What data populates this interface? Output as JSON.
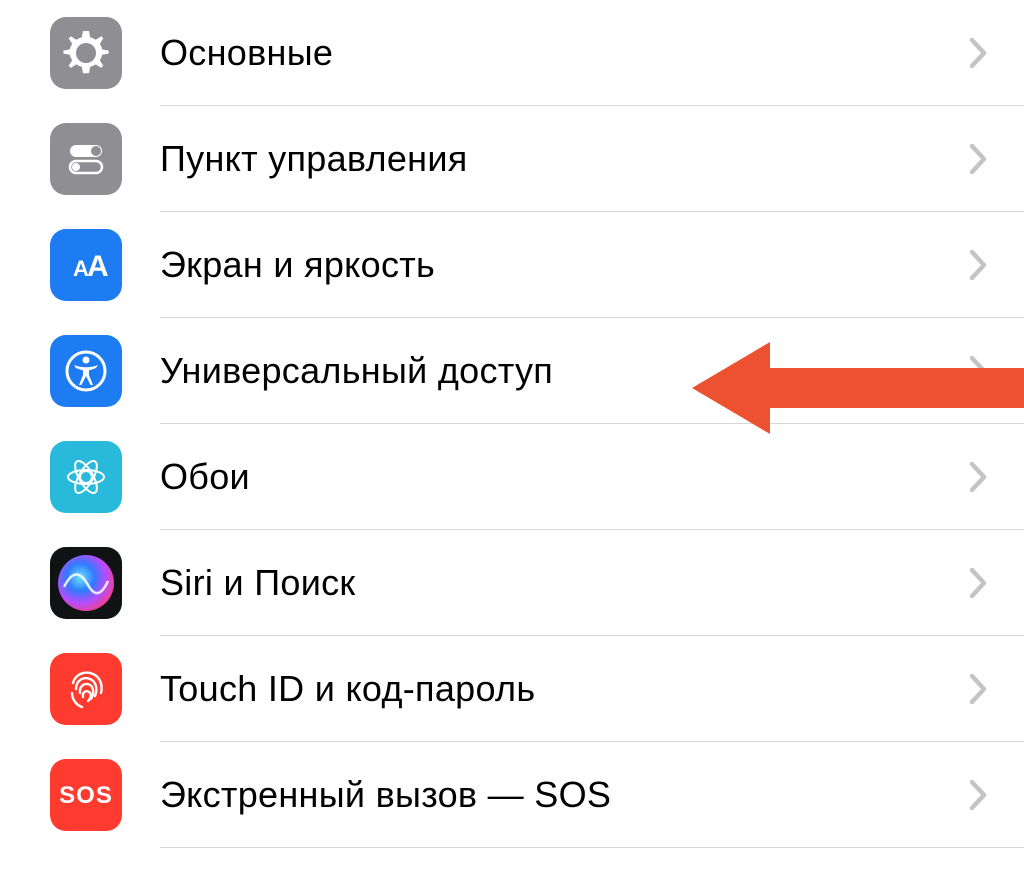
{
  "colors": {
    "gray": "#8e8e93",
    "blue": "#1e7cf3",
    "cyan": "#29badb",
    "red": "#ff3a2f",
    "sosRed": "#ff3a2f",
    "dark": "#111214",
    "arrow": "#ec5232",
    "chevron": "#c4c4c7"
  },
  "items": [
    {
      "id": "general",
      "label": "Основные"
    },
    {
      "id": "control-center",
      "label": "Пункт управления"
    },
    {
      "id": "display",
      "label": "Экран и яркость"
    },
    {
      "id": "accessibility",
      "label": "Универсальный доступ"
    },
    {
      "id": "wallpaper",
      "label": "Обои"
    },
    {
      "id": "siri",
      "label": "Siri и Поиск"
    },
    {
      "id": "touchid",
      "label": "Touch ID и код-пароль"
    },
    {
      "id": "sos",
      "label": "Экстренный вызов — SOS"
    }
  ],
  "annotation": {
    "target": "accessibility"
  }
}
